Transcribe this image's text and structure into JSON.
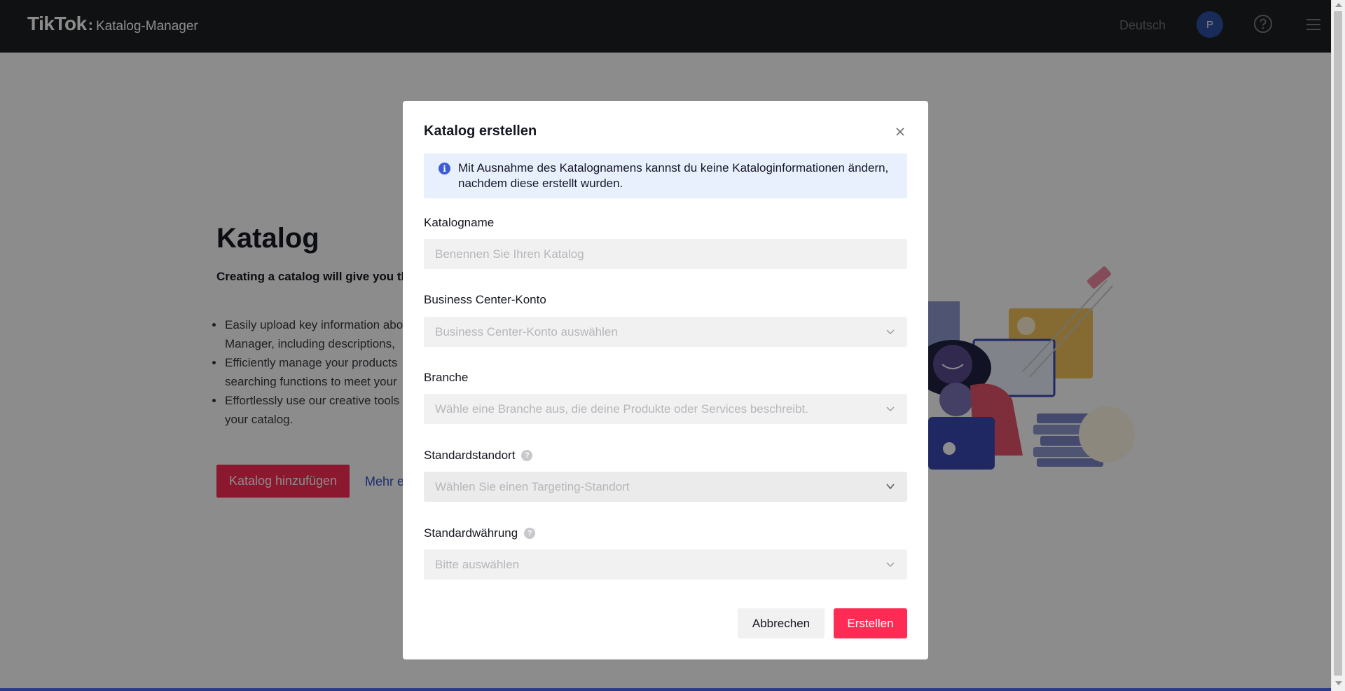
{
  "header": {
    "brand_logo": "TikTok",
    "brand_colon": ":",
    "product": "Katalog-Manager",
    "language": "Deutsch",
    "avatar_initial": "P"
  },
  "page": {
    "title": "Katalog",
    "subtitle": "Creating a catalog will give you th",
    "bullets": [
      [
        "Easily upload key information abo",
        "Manager, including descriptions,"
      ],
      [
        "Efficiently manage your products",
        "searching functions to meet your"
      ],
      [
        "Effortlessly use our creative tools",
        "your catalog."
      ]
    ],
    "add_button": "Katalog hinzufügen",
    "more_link": "Mehr e"
  },
  "modal": {
    "title": "Katalog erstellen",
    "notice": "Mit Ausnahme des Katalognamens kannst du keine Kataloginformationen ändern, nachdem diese erstellt wurden.",
    "fields": {
      "catalog_name": {
        "label": "Katalogname",
        "placeholder": "Benennen Sie Ihren Katalog",
        "value": ""
      },
      "business_center": {
        "label": "Business Center-Konto",
        "placeholder": "Business Center-Konto auswählen"
      },
      "industry": {
        "label": "Branche",
        "placeholder": "Wähle eine Branche aus, die deine Produkte oder Services beschreibt."
      },
      "default_location": {
        "label": "Standardstandort",
        "placeholder": "Wählen Sie einen Targeting-Standort"
      },
      "default_currency": {
        "label": "Standardwährung",
        "placeholder": "Bitte auswählen"
      }
    },
    "cancel": "Abbrechen",
    "create": "Erstellen"
  },
  "colors": {
    "accent": "#fe2c55",
    "notice_bg": "#e8f0fe",
    "header_bg": "#1e1f21",
    "avatar_bg": "#2f4fa0"
  }
}
